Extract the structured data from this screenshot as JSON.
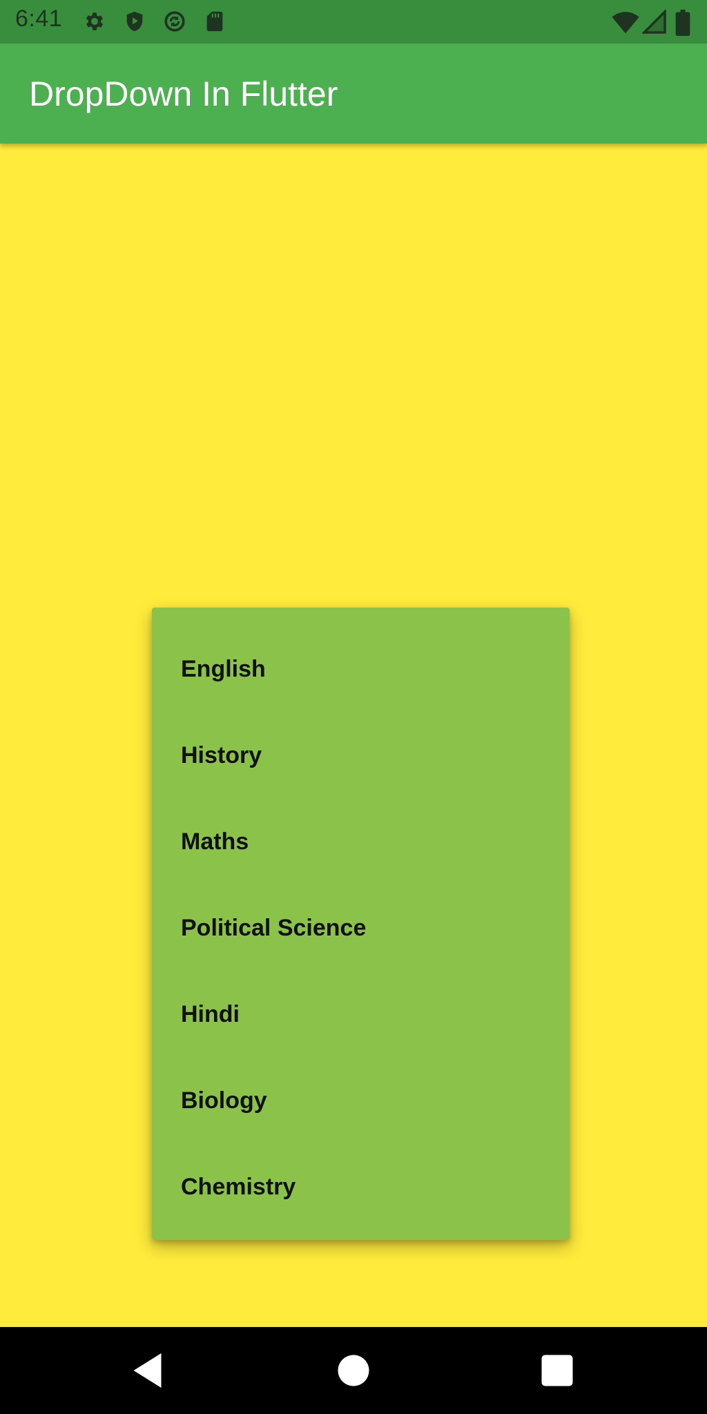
{
  "status_bar": {
    "time": "6:41",
    "icons": [
      "gear-icon",
      "shield-play-icon",
      "sync-circle-icon",
      "sd-card-icon",
      "wifi-icon",
      "signal-icon",
      "battery-icon"
    ]
  },
  "app_bar": {
    "title": "DropDown In Flutter"
  },
  "dropdown": {
    "items": [
      {
        "label": "English"
      },
      {
        "label": "History"
      },
      {
        "label": "Maths"
      },
      {
        "label": "Political Science"
      },
      {
        "label": "Hindi"
      },
      {
        "label": "Biology"
      },
      {
        "label": "Chemistry"
      }
    ]
  },
  "nav_bar": {
    "buttons": [
      "back-icon",
      "home-icon",
      "recents-icon"
    ]
  },
  "colors": {
    "status_bar": "#388E3C",
    "app_bar": "#4CAF50",
    "background": "#FFEB3B",
    "menu": "#8BC34A"
  }
}
